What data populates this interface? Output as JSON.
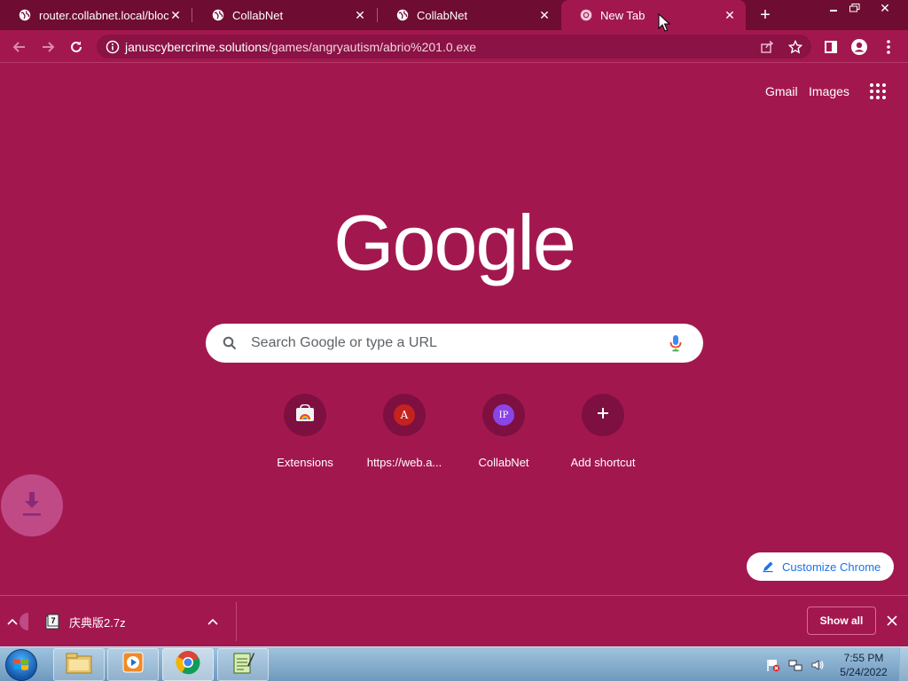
{
  "tabs": [
    {
      "title": "router.collabnet.local/block",
      "favicon": "globe-icon",
      "active": false
    },
    {
      "title": "CollabNet",
      "favicon": "globe-icon",
      "active": false
    },
    {
      "title": "CollabNet",
      "favicon": "globe-icon",
      "active": false
    },
    {
      "title": "New Tab",
      "favicon": "chrome-icon",
      "active": true
    }
  ],
  "address_bar": {
    "host": "januscybercrime.solutions",
    "path": "/games/angryautism/abrio%201.0.exe"
  },
  "ntp": {
    "header_links": {
      "gmail": "Gmail",
      "images": "Images"
    },
    "logo_text": "Google",
    "search_placeholder": "Search Google or type a URL",
    "shortcuts": [
      {
        "label": "Extensions",
        "icon": "chrome-web-store-icon"
      },
      {
        "label": "https://web.a...",
        "icon": "letter-avatar",
        "letter": "A"
      },
      {
        "label": "CollabNet",
        "icon": "letter-avatar",
        "letter": "IP"
      },
      {
        "label": "Add shortcut",
        "icon": "plus-icon"
      }
    ],
    "customize_label": "Customize Chrome"
  },
  "download_shelf": {
    "file_name": "庆典版2.7z",
    "show_all_label": "Show all"
  },
  "taskbar": {
    "apps": [
      "file-explorer-icon",
      "media-player-icon",
      "chrome-icon",
      "notepad-icon"
    ],
    "time": "7:55 PM",
    "date": "5/24/2022"
  },
  "colors": {
    "theme": "#a3174f",
    "tabstrip": "#6f0c31",
    "omnibox": "#8a1244",
    "link_blue": "#1a73e8"
  }
}
